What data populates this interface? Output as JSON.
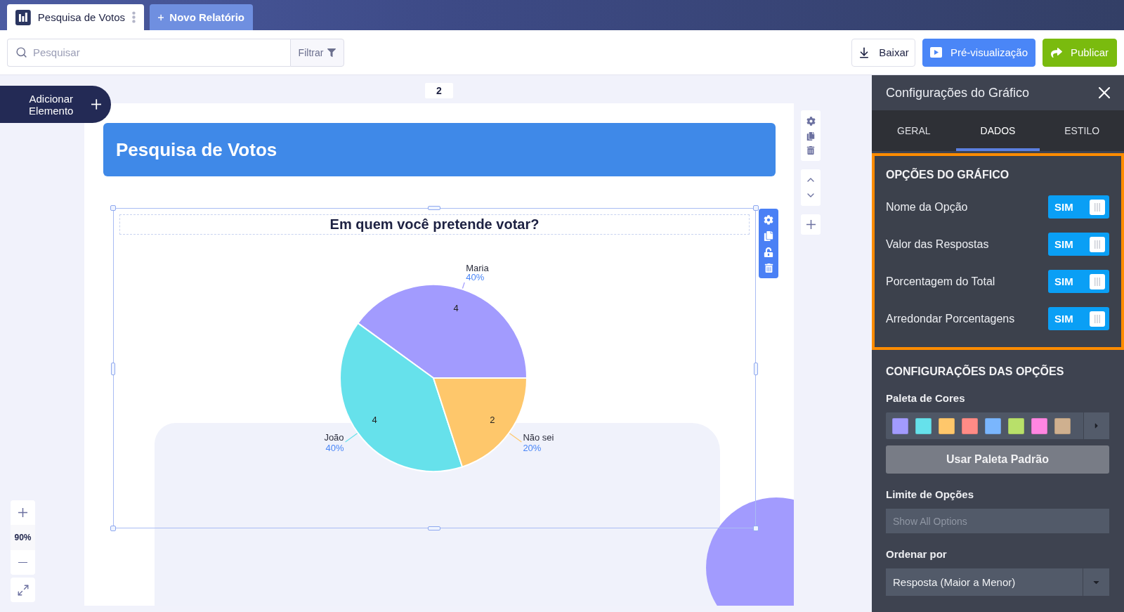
{
  "tabs": [
    {
      "label": "Pesquisa de Votos",
      "selected": true
    }
  ],
  "new_report": {
    "label": "Novo Relatório"
  },
  "toolbar": {
    "search": {
      "placeholder": "Pesquisar"
    },
    "filter": {
      "label": "Filtrar"
    },
    "buttons": [
      {
        "kind": "download",
        "label": "Baixar"
      },
      {
        "kind": "preview",
        "label": "Pré-visualização"
      },
      {
        "kind": "publish",
        "label": "Publicar"
      }
    ]
  },
  "canvas": {
    "add_element": {
      "label": "Adicionar Elemento"
    },
    "page_number": "2",
    "report_title": "Pesquisa de Votos",
    "chart": {
      "chart_data": {
        "type": "pie",
        "title": "Em quem você pretende votar?",
        "categories": [
          "Maria",
          "João",
          "Não sei"
        ],
        "values": [
          4,
          4,
          2
        ],
        "data_labels": true,
        "annotations": [
          {
            "text": "40%"
          },
          {
            "text": "40%"
          },
          {
            "text": "20%"
          }
        ]
      }
    },
    "zoom": {
      "reading": "90%"
    }
  },
  "panel": {
    "title": "Configurações do Gráfico",
    "tabs": [
      {
        "label": "GERAL",
        "selected": false
      },
      {
        "label": "DADOS",
        "selected": true
      },
      {
        "label": "ESTILO",
        "selected": false
      }
    ],
    "chart_options": {
      "heading": "OPÇÕES DO GRÁFICO",
      "highlighted": true,
      "toggles": [
        {
          "label": "Nome da Opção",
          "on": true,
          "text": "SIM"
        },
        {
          "label": "Valor das Respostas",
          "on": true,
          "text": "SIM"
        },
        {
          "label": "Porcentagem do Total",
          "on": true,
          "text": "SIM"
        },
        {
          "label": "Arredondar Porcentagens",
          "on": true,
          "text": "SIM"
        }
      ]
    },
    "option_settings": {
      "heading": "CONFIGURAÇÕES DAS OPÇÕES",
      "palette": {
        "label": "Paleta de Cores",
        "colors": [
          {
            "color": "#a29bfe"
          },
          {
            "color": "#66e1eb"
          },
          {
            "color": "#fec76b"
          },
          {
            "color": "#ff8b86"
          },
          {
            "color": "#7ab6fd"
          },
          {
            "color": "#b8e06a"
          },
          {
            "color": "#ff86e2"
          },
          {
            "color": "#cfb08f"
          }
        ]
      },
      "default_palette_button": "Usar Paleta Padrão",
      "limit": {
        "label": "Limite de Opções",
        "placeholder": "Show All Options"
      },
      "sort": {
        "label": "Ordenar por",
        "value": "Resposta (Maior a Menor)"
      }
    }
  }
}
